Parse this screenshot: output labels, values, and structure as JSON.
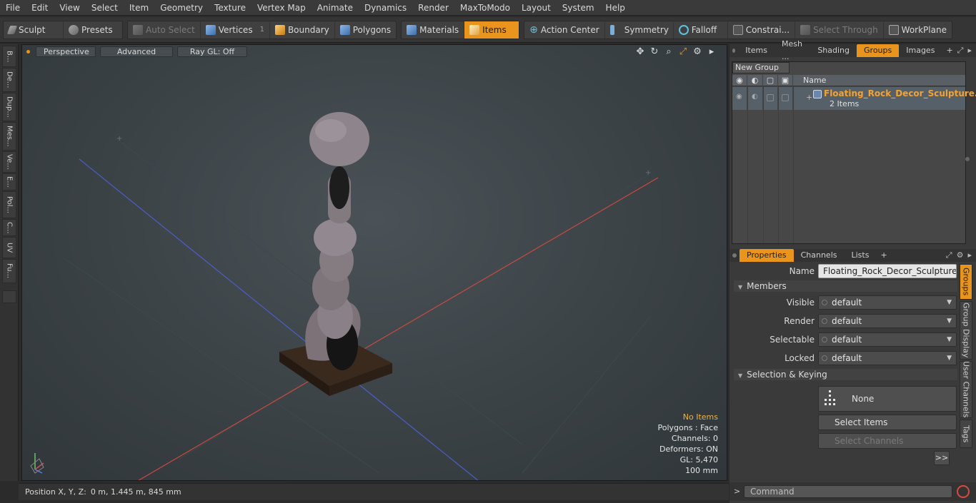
{
  "menu": [
    "File",
    "Edit",
    "View",
    "Select",
    "Item",
    "Geometry",
    "Texture",
    "Vertex Map",
    "Animate",
    "Dynamics",
    "Render",
    "MaxToModo",
    "Layout",
    "System",
    "Help"
  ],
  "toolbar": {
    "sculpt": "Sculpt",
    "presets": "Presets",
    "auto_select": "Auto Select",
    "vertices": "Vertices",
    "vertices_count": "1",
    "boundary": "Boundary",
    "polygons": "Polygons",
    "materials": "Materials",
    "items": "Items",
    "action_center": "Action Center",
    "symmetry": "Symmetry",
    "falloff": "Falloff",
    "constraints": "Constrai...",
    "select_through": "Select Through",
    "workplane": "WorkPlane"
  },
  "left_tabs": [
    "B...",
    "De...",
    "Dup...",
    "Mes...",
    "Ve...",
    "E...",
    "Pol...",
    "C...",
    "UV",
    "Fu..."
  ],
  "viewport": {
    "perspective": "Perspective",
    "advanced": "Advanced",
    "raygl": "Ray GL: Off",
    "info": {
      "items": "No Items",
      "polygons": "Polygons : Face",
      "channels": "Channels: 0",
      "deformers": "Deformers: ON",
      "gl": "GL: 5,470",
      "scale": "100 mm"
    }
  },
  "status": {
    "label": "Position X, Y, Z:",
    "value": "0 m, 1.445 m, 845 mm"
  },
  "top_tabs": [
    "Items",
    "Mesh ...",
    "Shading",
    "Groups",
    "Images"
  ],
  "groups": {
    "new_group": "New Group",
    "header_name": "Name",
    "item_name": "Floating_Rock_Decor_Sculpture...",
    "item_count": "2 Items"
  },
  "props_tabs": [
    "Properties",
    "Channels",
    "Lists"
  ],
  "properties": {
    "name_label": "Name",
    "name_value": "Floating_Rock_Decor_Sculpture_Lilac",
    "members": "Members",
    "visible_label": "Visible",
    "visible_value": "default",
    "render_label": "Render",
    "render_value": "default",
    "selectable_label": "Selectable",
    "selectable_value": "default",
    "locked_label": "Locked",
    "locked_value": "default",
    "selection_keying": "Selection & Keying",
    "none": "None",
    "select_items": "Select Items",
    "select_channels": "Select Channels",
    "more": ">>"
  },
  "side_tabs": [
    "Groups",
    "Group Display",
    "User Channels",
    "Tags"
  ],
  "command": {
    "prompt": ">",
    "placeholder": "Command"
  },
  "colors": {
    "accent": "#e8941d",
    "item_name": "#f3a233",
    "axis_red": "#c84a3e",
    "axis_blue": "#4a5fc8"
  }
}
